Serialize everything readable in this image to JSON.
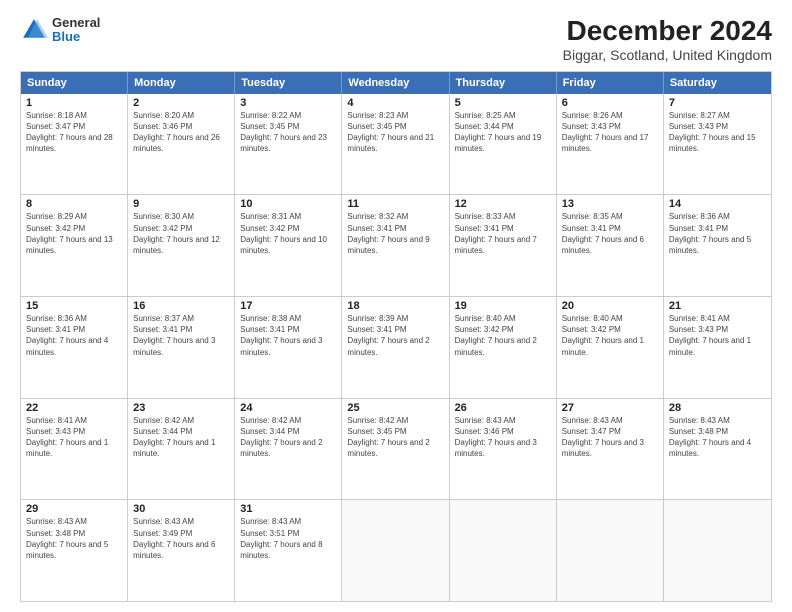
{
  "header": {
    "logo": {
      "general": "General",
      "blue": "Blue"
    },
    "title": "December 2024",
    "subtitle": "Biggar, Scotland, United Kingdom"
  },
  "weekdays": [
    "Sunday",
    "Monday",
    "Tuesday",
    "Wednesday",
    "Thursday",
    "Friday",
    "Saturday"
  ],
  "weeks": [
    [
      {
        "day": "1",
        "sunrise": "8:18 AM",
        "sunset": "3:47 PM",
        "daylight": "7 hours and 28 minutes."
      },
      {
        "day": "2",
        "sunrise": "8:20 AM",
        "sunset": "3:46 PM",
        "daylight": "7 hours and 26 minutes."
      },
      {
        "day": "3",
        "sunrise": "8:22 AM",
        "sunset": "3:45 PM",
        "daylight": "7 hours and 23 minutes."
      },
      {
        "day": "4",
        "sunrise": "8:23 AM",
        "sunset": "3:45 PM",
        "daylight": "7 hours and 21 minutes."
      },
      {
        "day": "5",
        "sunrise": "8:25 AM",
        "sunset": "3:44 PM",
        "daylight": "7 hours and 19 minutes."
      },
      {
        "day": "6",
        "sunrise": "8:26 AM",
        "sunset": "3:43 PM",
        "daylight": "7 hours and 17 minutes."
      },
      {
        "day": "7",
        "sunrise": "8:27 AM",
        "sunset": "3:43 PM",
        "daylight": "7 hours and 15 minutes."
      }
    ],
    [
      {
        "day": "8",
        "sunrise": "8:29 AM",
        "sunset": "3:42 PM",
        "daylight": "7 hours and 13 minutes."
      },
      {
        "day": "9",
        "sunrise": "8:30 AM",
        "sunset": "3:42 PM",
        "daylight": "7 hours and 12 minutes."
      },
      {
        "day": "10",
        "sunrise": "8:31 AM",
        "sunset": "3:42 PM",
        "daylight": "7 hours and 10 minutes."
      },
      {
        "day": "11",
        "sunrise": "8:32 AM",
        "sunset": "3:41 PM",
        "daylight": "7 hours and 9 minutes."
      },
      {
        "day": "12",
        "sunrise": "8:33 AM",
        "sunset": "3:41 PM",
        "daylight": "7 hours and 7 minutes."
      },
      {
        "day": "13",
        "sunrise": "8:35 AM",
        "sunset": "3:41 PM",
        "daylight": "7 hours and 6 minutes."
      },
      {
        "day": "14",
        "sunrise": "8:36 AM",
        "sunset": "3:41 PM",
        "daylight": "7 hours and 5 minutes."
      }
    ],
    [
      {
        "day": "15",
        "sunrise": "8:36 AM",
        "sunset": "3:41 PM",
        "daylight": "7 hours and 4 minutes."
      },
      {
        "day": "16",
        "sunrise": "8:37 AM",
        "sunset": "3:41 PM",
        "daylight": "7 hours and 3 minutes."
      },
      {
        "day": "17",
        "sunrise": "8:38 AM",
        "sunset": "3:41 PM",
        "daylight": "7 hours and 3 minutes."
      },
      {
        "day": "18",
        "sunrise": "8:39 AM",
        "sunset": "3:41 PM",
        "daylight": "7 hours and 2 minutes."
      },
      {
        "day": "19",
        "sunrise": "8:40 AM",
        "sunset": "3:42 PM",
        "daylight": "7 hours and 2 minutes."
      },
      {
        "day": "20",
        "sunrise": "8:40 AM",
        "sunset": "3:42 PM",
        "daylight": "7 hours and 1 minute."
      },
      {
        "day": "21",
        "sunrise": "8:41 AM",
        "sunset": "3:43 PM",
        "daylight": "7 hours and 1 minute."
      }
    ],
    [
      {
        "day": "22",
        "sunrise": "8:41 AM",
        "sunset": "3:43 PM",
        "daylight": "7 hours and 1 minute."
      },
      {
        "day": "23",
        "sunrise": "8:42 AM",
        "sunset": "3:44 PM",
        "daylight": "7 hours and 1 minute."
      },
      {
        "day": "24",
        "sunrise": "8:42 AM",
        "sunset": "3:44 PM",
        "daylight": "7 hours and 2 minutes."
      },
      {
        "day": "25",
        "sunrise": "8:42 AM",
        "sunset": "3:45 PM",
        "daylight": "7 hours and 2 minutes."
      },
      {
        "day": "26",
        "sunrise": "8:43 AM",
        "sunset": "3:46 PM",
        "daylight": "7 hours and 3 minutes."
      },
      {
        "day": "27",
        "sunrise": "8:43 AM",
        "sunset": "3:47 PM",
        "daylight": "7 hours and 3 minutes."
      },
      {
        "day": "28",
        "sunrise": "8:43 AM",
        "sunset": "3:48 PM",
        "daylight": "7 hours and 4 minutes."
      }
    ],
    [
      {
        "day": "29",
        "sunrise": "8:43 AM",
        "sunset": "3:48 PM",
        "daylight": "7 hours and 5 minutes."
      },
      {
        "day": "30",
        "sunrise": "8:43 AM",
        "sunset": "3:49 PM",
        "daylight": "7 hours and 6 minutes."
      },
      {
        "day": "31",
        "sunrise": "8:43 AM",
        "sunset": "3:51 PM",
        "daylight": "7 hours and 8 minutes."
      },
      null,
      null,
      null,
      null
    ]
  ]
}
